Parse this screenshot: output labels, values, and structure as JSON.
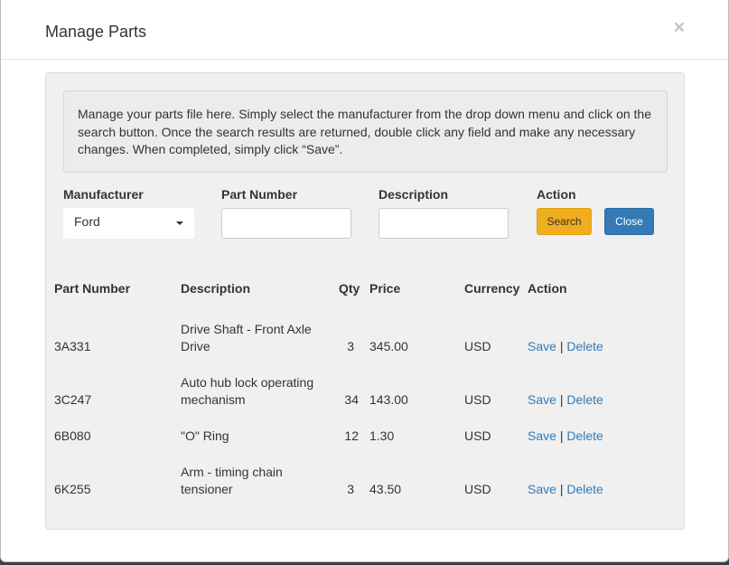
{
  "modal": {
    "title": "Manage Parts",
    "close_symbol": "×"
  },
  "info": {
    "text": "Manage your parts file here. Simply select the manufacturer from the drop down menu and click on the search button. Once the search results are returned, double click any field and make any necessary changes. When completed, simply click “Save”."
  },
  "form": {
    "manufacturer_label": "Manufacturer",
    "manufacturer_value": "Ford",
    "part_number_label": "Part Number",
    "part_number_value": "",
    "description_label": "Description",
    "description_value": "",
    "action_label": "Action",
    "search_label": "Search",
    "close_label": "Close"
  },
  "table": {
    "headers": [
      "Part Number",
      "Description",
      "Qty",
      "Price",
      "Currency",
      "Action"
    ],
    "rows": [
      {
        "part": "3A331",
        "desc": "Drive Shaft - Front Axle Drive",
        "qty": "3",
        "price": "345.00",
        "currency": "USD",
        "save": "Save",
        "sep": "|",
        "delete": "Delete"
      },
      {
        "part": "3C247",
        "desc": "Auto hub lock operating mechanism",
        "qty": "34",
        "price": "143.00",
        "currency": "USD",
        "save": "Save",
        "sep": "|",
        "delete": "Delete"
      },
      {
        "part": "6B080",
        "desc": "\"O\" Ring",
        "qty": "12",
        "price": "1.30",
        "currency": "USD",
        "save": "Save",
        "sep": "|",
        "delete": "Delete"
      },
      {
        "part": "6K255",
        "desc": "Arm - timing chain tensioner",
        "qty": "3",
        "price": "43.50",
        "currency": "USD",
        "save": "Save",
        "sep": "|",
        "delete": "Delete"
      }
    ]
  },
  "colors": {
    "search_button": "#f0ad1e",
    "close_button": "#337ab7",
    "link": "#337ab7"
  }
}
